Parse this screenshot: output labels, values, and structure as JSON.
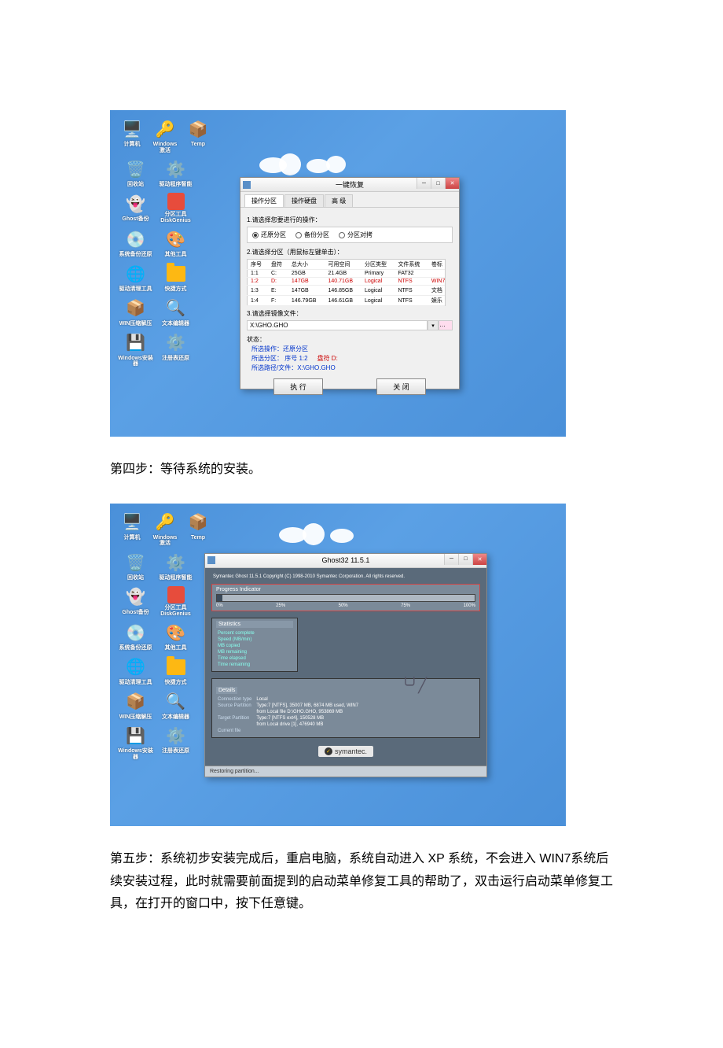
{
  "icons": {
    "computer": "计算机",
    "windows_activate": "Windows激活",
    "temp": "Temp",
    "recycle": "回收站",
    "driver_prog": "驱动程序智能",
    "ghost_backup": "Ghost备份",
    "disk_genius": "分区工具 DiskGenius",
    "system_backup": "系统备份还原",
    "other_tool": "其他工具",
    "driver_clean": "驱动清理工具",
    "quick_share": "快捷方式",
    "win_compress": "WIN压缩解压",
    "text_editor": "文本编辑器",
    "windows_install": "Windows安装器",
    "registry_restore": "注册表还原"
  },
  "dialog1": {
    "title": "一键恢复",
    "tabs": [
      "操作分区",
      "操作硬盘",
      "高 级"
    ],
    "section1_label": "1.请选择您要进行的操作：",
    "radio_restore": "还原分区",
    "radio_backup": "备份分区",
    "radio_compare": "分区对拷",
    "section2_label": "2.请选择分区（用鼠标左键单击）：",
    "table_headers": [
      "序号",
      "盘符",
      "总大小",
      "可用空间",
      "分区类型",
      "文件系统",
      "卷标"
    ],
    "table_rows": [
      [
        "1:1",
        "C:",
        "25GB",
        "21.4GB",
        "Primary",
        "FAT32",
        ""
      ],
      [
        "1:2",
        "D:",
        "147GB",
        "140.71GB",
        "Logical",
        "NTFS",
        "WIN7"
      ],
      [
        "1:3",
        "E:",
        "147GB",
        "146.85GB",
        "Logical",
        "NTFS",
        "文档"
      ],
      [
        "1:4",
        "F:",
        "146.79GB",
        "146.61GB",
        "Logical",
        "NTFS",
        "娱乐"
      ]
    ],
    "section3_label": "3.请选择镜像文件：",
    "image_path": "X:\\GHO.GHO",
    "status_label": "状态：",
    "status_op": "所选操作：还原分区",
    "status_part": "所选分区：  序号 1:2",
    "status_disk": "盘符 D:",
    "status_path": "所选路径/文件：X:\\GHO.GHO",
    "btn_execute": "执 行",
    "btn_close": "关 闭"
  },
  "step4_text": "第四步：等待系统的安装。",
  "dialog2": {
    "title": "Ghost32 11.5.1",
    "copyright": "Symantec Ghost 11.5.1    Copyright (C) 1998-2010 Symantec Corporation. All rights reserved.",
    "progress_label": "Progress Indicator",
    "ticks": [
      "0%",
      "25%",
      "50%",
      "75%",
      "100%"
    ],
    "stats_label": "Statistics",
    "stats": [
      "Percent complete",
      "Speed (MB/min)",
      "MB copied",
      "MB remaining",
      "Time elapsed",
      "Time remaining"
    ],
    "details_label": "Details",
    "details": [
      [
        "Connection type",
        "Local"
      ],
      [
        "Source Partition",
        "Type:7 [NTFS], 35007 MB, 6874 MB used, WIN7"
      ],
      [
        "",
        "from Local file D:\\GHO.GHO, 953869 MB"
      ],
      [
        "Target Partition",
        "Type:7 [NTFS ext4], 150528 MB"
      ],
      [
        "",
        "from Local drive [1], 476940 MB"
      ],
      [
        "Current file",
        ""
      ]
    ],
    "brand": "symantec.",
    "statusbar": "Restoring partition..."
  },
  "step5_text": "第五步：系统初步安装完成后，重启电脑，系统自动进入 XP 系统，不会进入 WIN7系统后续安装过程，此时就需要前面提到的启动菜单修复工具的帮助了，双击运行启动菜单修复工具，在打开的窗口中，按下任意键。"
}
